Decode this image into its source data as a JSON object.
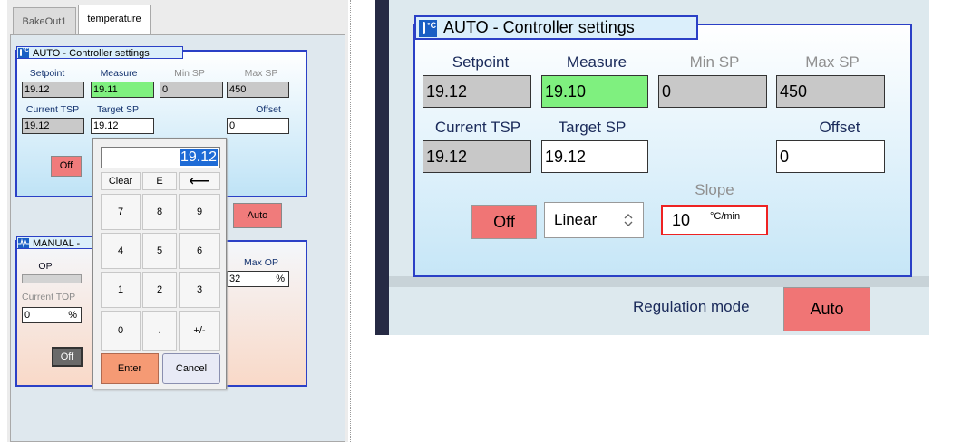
{
  "tabs": [
    {
      "label": "BakeOut1",
      "active": false
    },
    {
      "label": "temperature",
      "active": true
    }
  ],
  "left_auto": {
    "title": "AUTO - Controller settings",
    "setpoint_label": "Setpoint",
    "measure_label": "Measure",
    "min_sp_label": "Min SP",
    "max_sp_label": "Max SP",
    "setpoint_value": "19.12",
    "measure_value": "19.11",
    "min_sp_value": "0",
    "max_sp_value": "450",
    "current_tsp_label": "Current TSP",
    "target_sp_label": "Target SP",
    "offset_label": "Offset",
    "current_tsp_value": "19.12",
    "target_sp_value": "19.12",
    "offset_value": "0",
    "off_label": "Off"
  },
  "left_regulation": {
    "auto_label": "Auto"
  },
  "left_manual": {
    "title": "MANUAL -",
    "op_label": "OP",
    "max_op_label": "Max OP",
    "max_op_value": "32",
    "max_op_unit": "%",
    "current_top_label": "Current TOP",
    "current_top_value": "0",
    "current_top_unit": "%",
    "off_label": "Off"
  },
  "keypad": {
    "display_value": "19.12",
    "keys": {
      "clear": "Clear",
      "e": "E",
      "back": "⟵",
      "k7": "7",
      "k8": "8",
      "k9": "9",
      "k4": "4",
      "k5": "5",
      "k6": "6",
      "k1": "1",
      "k2": "2",
      "k3": "3",
      "k0": "0",
      "dot": ".",
      "plusminus": "+/-",
      "enter": "Enter",
      "cancel": "Cancel"
    }
  },
  "right_auto": {
    "title": "AUTO - Controller settings",
    "setpoint_label": "Setpoint",
    "measure_label": "Measure",
    "min_sp_label": "Min SP",
    "max_sp_label": "Max SP",
    "setpoint_value": "19.12",
    "measure_value": "19.10",
    "min_sp_value": "0",
    "max_sp_value": "450",
    "current_tsp_label": "Current TSP",
    "target_sp_label": "Target SP",
    "offset_label": "Offset",
    "current_tsp_value": "19.12",
    "target_sp_value": "19.12",
    "offset_value": "0",
    "slope_label": "Slope",
    "slope_value": "10",
    "slope_unit": "°C/min",
    "off_label": "Off",
    "ramp_mode": "Linear"
  },
  "right_regulation": {
    "label": "Regulation mode",
    "auto_label": "Auto"
  },
  "colors": {
    "group_border": "#2b40c6",
    "measure_green": "#7ff07f",
    "off_red": "#f07575",
    "enter_orange": "#f59a74",
    "slope_border": "#ee2222"
  }
}
